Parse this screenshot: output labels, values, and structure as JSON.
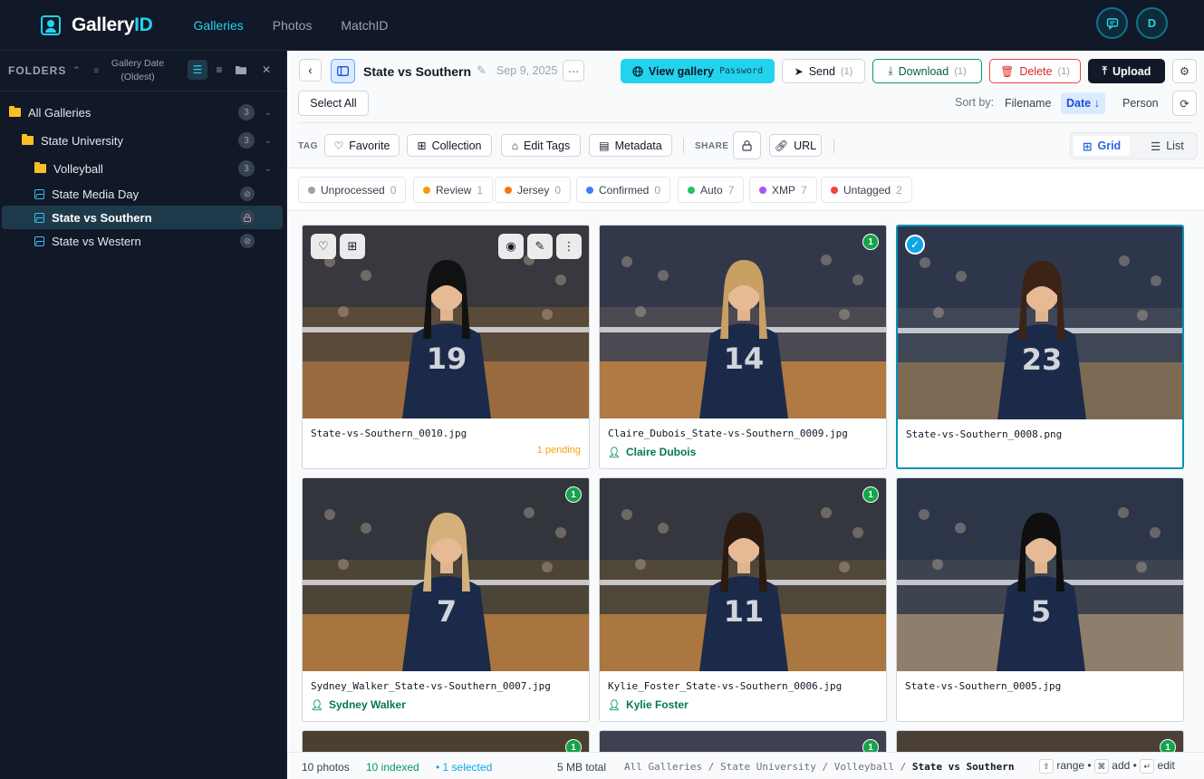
{
  "app": {
    "logo_part1": "Gallery",
    "logo_part2": "ID",
    "nav": [
      "Galleries",
      "Photos",
      "MatchID"
    ],
    "avatar": "D"
  },
  "sidebar": {
    "title": "FOLDERS",
    "sort_line1": "Gallery Date",
    "sort_line2": "(Oldest)",
    "items": [
      {
        "label": "All Galleries",
        "count": "3",
        "type": "folder"
      },
      {
        "label": "State University",
        "count": "3",
        "type": "folder"
      },
      {
        "label": "Volleyball",
        "count": "3",
        "type": "folder"
      },
      {
        "label": "State Media Day",
        "type": "gallery"
      },
      {
        "label": "State vs Southern",
        "type": "gallery",
        "active": true
      },
      {
        "label": "State vs Western",
        "type": "gallery"
      }
    ]
  },
  "header": {
    "title": "State vs Southern",
    "date": "Sep 9, 2025",
    "view_gallery": "View gallery",
    "password": "Password",
    "send": "Send",
    "send_count": "(1)",
    "download": "Download",
    "download_count": "(1)",
    "delete": "Delete",
    "delete_count": "(1)",
    "upload": "Upload",
    "select_all": "Select All",
    "sort_by": "Sort by:",
    "sort_options": [
      "Filename",
      "Date",
      "Person"
    ],
    "sort_active": "Date"
  },
  "tagbar": {
    "tag_label": "TAG",
    "favorite": "Favorite",
    "collection": "Collection",
    "edit_tags": "Edit Tags",
    "metadata": "Metadata",
    "share_label": "SHARE",
    "url": "URL",
    "grid": "Grid",
    "list": "List"
  },
  "filters": [
    {
      "label": "Unprocessed",
      "count": "0",
      "color": "#9ca3af"
    },
    {
      "label": "Review",
      "count": "1",
      "color": "#f59e0b"
    },
    {
      "label": "Jersey",
      "count": "0",
      "color": "#f97316"
    },
    {
      "label": "Confirmed",
      "count": "0",
      "color": "#3b82f6"
    },
    {
      "label": "Auto",
      "count": "7",
      "color": "#22c55e"
    },
    {
      "label": "XMP",
      "count": "7",
      "color": "#a855f7"
    },
    {
      "label": "Untagged",
      "count": "2",
      "color": "#ef4444"
    }
  ],
  "photos": [
    {
      "filename": "State-vs-Southern_0010.jpg",
      "person": "",
      "pending": "1 pending",
      "badge": "",
      "selected": false,
      "jersey": "19",
      "hair": "#111111",
      "hovered": true
    },
    {
      "filename": "Claire_Dubois_State-vs-Southern_0009.jpg",
      "person": "Claire Dubois",
      "pending": "",
      "badge": "1",
      "selected": false,
      "jersey": "14",
      "hair": "#c8a064"
    },
    {
      "filename": "State-vs-Southern_0008.png",
      "person": "",
      "pending": "",
      "badge": "",
      "selected": true,
      "jersey": "23",
      "hair": "#3b2316"
    },
    {
      "filename": "Sydney_Walker_State-vs-Southern_0007.jpg",
      "person": "Sydney Walker",
      "pending": "",
      "badge": "1",
      "selected": false,
      "jersey": "7",
      "hair": "#d4b07a"
    },
    {
      "filename": "Kylie_Foster_State-vs-Southern_0006.jpg",
      "person": "Kylie Foster",
      "pending": "",
      "badge": "1",
      "selected": false,
      "jersey": "11",
      "hair": "#2a1a10"
    },
    {
      "filename": "State-vs-Southern_0005.jpg",
      "person": "",
      "pending": "",
      "badge": "",
      "selected": false,
      "jersey": "5",
      "hair": "#0f0f0f"
    }
  ],
  "partial_badges": [
    "1",
    "1",
    "1"
  ],
  "status": {
    "photos": "10 photos",
    "indexed": "10 indexed",
    "selected": "• 1 selected",
    "total": "5 MB total",
    "crumb_path": "All Galleries / State University / Volleyball / ",
    "crumb_current": "State vs Southern",
    "hint_range": "range •",
    "hint_add": "add •",
    "hint_edit": "edit"
  },
  "colors": {
    "accent": "#22d3ee",
    "nav_bg": "#111827",
    "confirmed_green": "#16a34a"
  }
}
